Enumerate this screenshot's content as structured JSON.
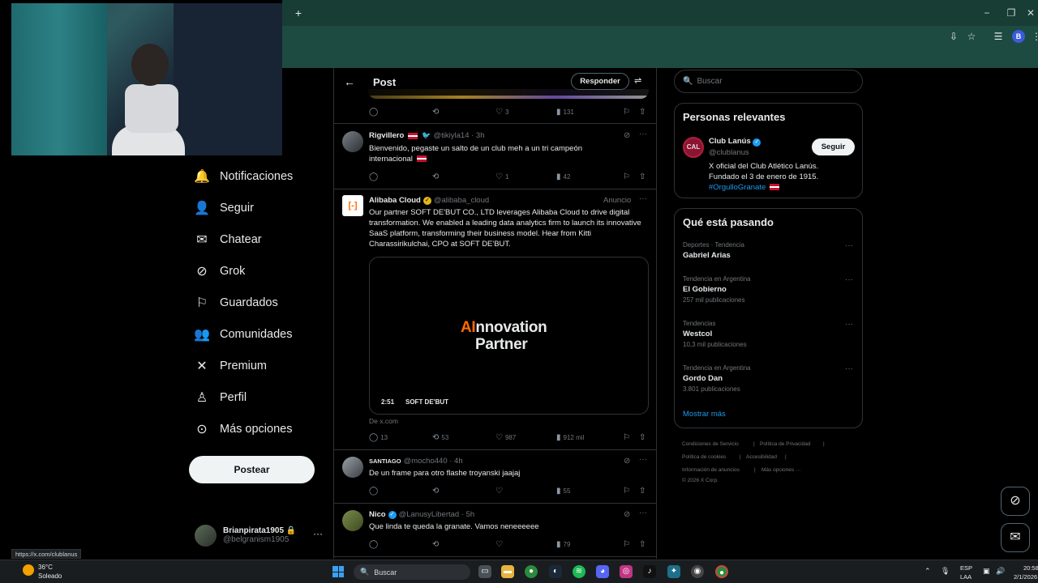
{
  "browser": {
    "new_tab_label": "+",
    "minimize": "−",
    "maximize": "❐",
    "close": "✕",
    "profile_initial": "B"
  },
  "status_url": "https://x.com/clublanus",
  "nav": {
    "items": [
      {
        "label": "Notificaciones",
        "icon": "bell-icon",
        "glyph": "🔔"
      },
      {
        "label": "Seguir",
        "icon": "follow-icon",
        "glyph": "👤"
      },
      {
        "label": "Chatear",
        "icon": "mail-icon",
        "glyph": "✉"
      },
      {
        "label": "Grok",
        "icon": "grok-icon",
        "glyph": "⊘"
      },
      {
        "label": "Guardados",
        "icon": "bookmark-icon",
        "glyph": "🔖"
      },
      {
        "label": "Comunidades",
        "icon": "communities-icon",
        "glyph": "👥"
      },
      {
        "label": "Premium",
        "icon": "x-logo-icon",
        "glyph": "𝕏"
      },
      {
        "label": "Perfil",
        "icon": "profile-icon",
        "glyph": "👤"
      },
      {
        "label": "Más opciones",
        "icon": "more-circle-icon",
        "glyph": "⋯"
      }
    ],
    "post_button": "Postear",
    "account": {
      "name": "Brianpirata1905",
      "handle": "@belgranism1905",
      "lock": "🔒",
      "more": "···"
    }
  },
  "post_header": {
    "title": "Post",
    "reply_button": "Responder",
    "back": "←"
  },
  "tweets": {
    "prev_actions": {
      "replies": "",
      "retweets": "",
      "likes": "3",
      "views": "131"
    },
    "t1": {
      "name": "Rigvillero",
      "handle": "@tikiyla14 · 3h",
      "text_1": "Bienvenido, pegaste un salto de un club meh a un tri campeón",
      "text_2": "internacional",
      "actions": {
        "replies": "",
        "retweets": "",
        "likes": "1",
        "views": "42"
      }
    },
    "ad": {
      "name": "Alibaba Cloud",
      "handle": "@alibaba_cloud",
      "tag": "Anuncio",
      "text": "Our partner SOFT DE'BUT CO., LTD leverages Alibaba Cloud to drive digital transformation. We enabled a leading data analytics firm to launch its innovative SaaS platform, transforming their business model. Hear from Kitti Charassirikulchai, CPO at SOFT DE'BUT.",
      "video_title_ai": "AI",
      "video_title_rest": "nnovation",
      "video_title_2": "Partner",
      "video_time": "2:51",
      "video_brand": "SOFT DE'BUT",
      "from": "De x.com",
      "actions": {
        "replies": "13",
        "retweets": "53",
        "likes": "987",
        "views": "912 mil"
      }
    },
    "t2": {
      "name": "SANTIAGO",
      "handle": "@mocho440 · 4h",
      "text": "De un frame para otro flashe troyanski jaajaj",
      "actions": {
        "replies": "",
        "retweets": "",
        "likes": "",
        "views": "55"
      }
    },
    "t3": {
      "name": "Nico",
      "handle": "@LanusyLibertad · 5h",
      "text": "Que linda te queda la granate. Vamos neneeeeee",
      "actions": {
        "replies": "",
        "retweets": "",
        "likes": "",
        "views": "79"
      }
    }
  },
  "right": {
    "search_placeholder": "Buscar",
    "relevant": {
      "title": "Personas relevantes",
      "name": "Club Lanús",
      "handle": "@clublanus",
      "follow": "Seguir",
      "bio_1": "X oficial del Club Atlético Lanús.",
      "bio_2": "Fundado el 3 de enero de 1915.",
      "hashtag": "#OrgulloGranate"
    },
    "trends": {
      "title": "Qué está pasando",
      "items": [
        {
          "context": "Deportes · Tendencia",
          "title": "Gabriel Arias",
          "count": ""
        },
        {
          "context": "Tendencia en Argentina",
          "title": "El Gobierno",
          "count": "257 mil publicaciones"
        },
        {
          "context": "Tendencias",
          "title": "Westcol",
          "count": "10,3 mil publicaciones"
        },
        {
          "context": "Tendencia en Argentina",
          "title": "Gordo Dan",
          "count": "3.801 publicaciones"
        }
      ],
      "show_more": "Mostrar más"
    },
    "footer": {
      "terms": "Condiciones de Servicio",
      "privacy": "Política de Privacidad",
      "cookies": "Política de cookies",
      "accessibility": "Accesibilidad",
      "ads": "Información de anuncios",
      "more": "Más opciones ···",
      "copyright": "© 2026 X Corp."
    }
  },
  "taskbar": {
    "weather_temp": "36°C",
    "weather_desc": "Soleado",
    "search_label": "Buscar",
    "lang_1": "ESP",
    "lang_2": "LAA",
    "time": "20:58",
    "date": "2/1/2026"
  }
}
